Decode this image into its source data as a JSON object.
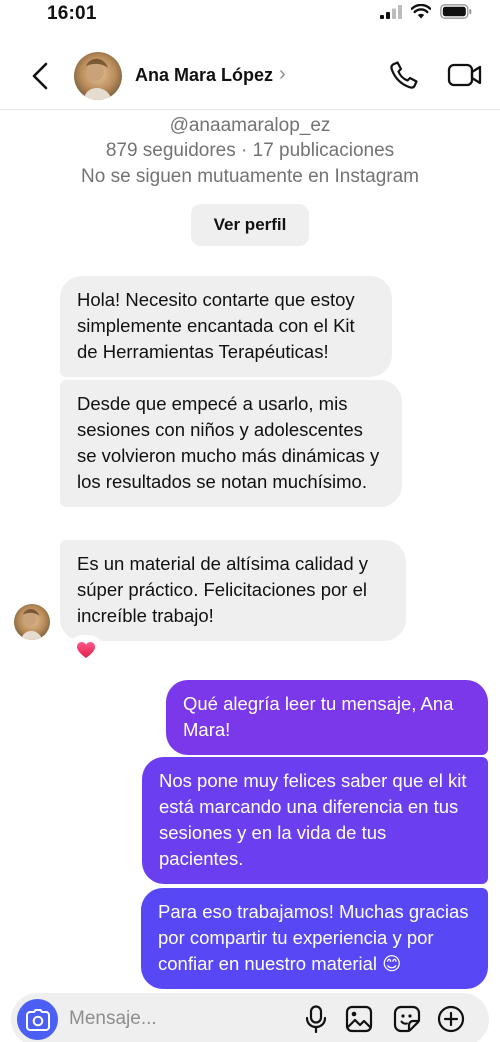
{
  "status_bar": {
    "time": "16:01",
    "icons": [
      "signal-icon",
      "wifi-icon",
      "battery-icon"
    ]
  },
  "header": {
    "contact_name": "Ana Mara López",
    "chevron": "›",
    "icons": [
      "back-arrow-icon",
      "phone-icon",
      "video-camera-icon"
    ]
  },
  "profile": {
    "handle": "@anaamaralop_ez",
    "stats": "879 seguidores · 17 publicaciones",
    "mutual": "No se siguen mutuamente en Instagram",
    "view_profile_label": "Ver perfil"
  },
  "messages": [
    {
      "from": "contact",
      "text": "Hola! Necesito contarte que estoy simplemente encantada con el Kit de Herramientas Terapéuticas!"
    },
    {
      "from": "contact",
      "text": "Desde que empecé a usarlo, mis sesiones con niños y adolescentes se volvieron mucho más dinámicas y los resultados se notan muchísimo."
    },
    {
      "from": "contact",
      "text": "Es un material de altísima calidad y súper práctico. Felicitaciones por el increíble trabajo!",
      "reaction": "❤"
    },
    {
      "from": "me",
      "text": "Qué alegría leer tu mensaje, Ana Mara!"
    },
    {
      "from": "me",
      "text": "Nos pone muy felices saber que el kit está marcando una diferencia en tus sesiones y en la vida de tus pacientes."
    },
    {
      "from": "me",
      "text": "Para eso trabajamos! Muchas gracias por compartir tu experiencia y por confiar en nuestro material 😊"
    }
  ],
  "composer": {
    "placeholder": "Mensaje...",
    "icons": [
      "camera-icon",
      "microphone-icon",
      "gallery-icon",
      "sticker-icon",
      "plus-icon"
    ]
  },
  "colors": {
    "outgoing_1": "#7a38ea",
    "outgoing_2": "#6b3ff0",
    "outgoing_3": "#5847f5",
    "incoming": "#efefef",
    "camera_button": "#4c5ff5"
  }
}
